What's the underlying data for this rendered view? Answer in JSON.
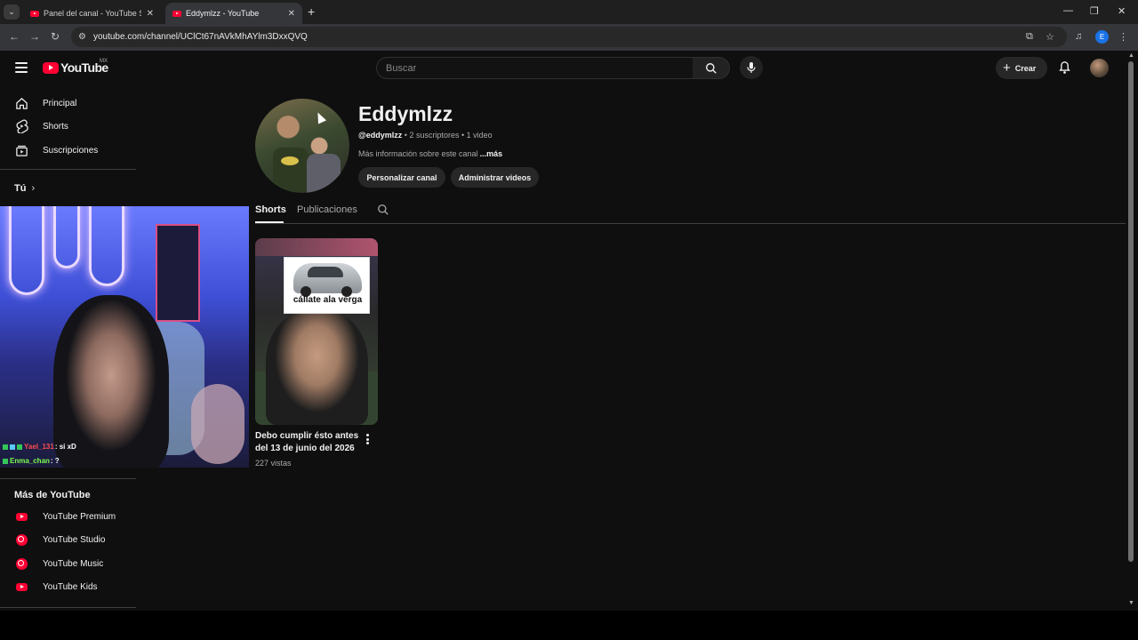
{
  "browser": {
    "tabs": [
      {
        "title": "Panel del canal - YouTube Studio",
        "close": "✕"
      },
      {
        "title": "Eddymlzz - YouTube",
        "close": "✕"
      }
    ],
    "new_tab": "+",
    "window_controls": {
      "minimize": "—",
      "restore": "❐",
      "close": "✕"
    },
    "url": "youtube.com/channel/UClCt67nAVkMhAYlm3DxxQVQ",
    "profile_initial": "E"
  },
  "masthead": {
    "logo_text": "YouTube",
    "region": "MX",
    "search_placeholder": "Buscar",
    "create_label": "Crear"
  },
  "sidebar": {
    "main_items": [
      {
        "label": "Principal",
        "icon": "home-icon"
      },
      {
        "label": "Shorts",
        "icon": "shorts-icon"
      },
      {
        "label": "Suscripciones",
        "icon": "subscriptions-icon"
      }
    ],
    "you_label": "Tú",
    "you_chevron": "›",
    "more_heading": "Más de YouTube",
    "more_items": [
      {
        "label": "YouTube Premium",
        "icon": "youtube-premium-icon"
      },
      {
        "label": "YouTube Studio",
        "icon": "youtube-studio-icon"
      },
      {
        "label": "YouTube Music",
        "icon": "youtube-music-icon"
      },
      {
        "label": "YouTube Kids",
        "icon": "youtube-kids-icon"
      }
    ]
  },
  "webcam_chat": [
    {
      "user": "Yael_131",
      "message": ": si xD",
      "user_color": "#ff4d4d"
    },
    {
      "user": "Enma_chan",
      "message": ": ?",
      "user_color": "#7cff4f"
    }
  ],
  "channel": {
    "name": "Eddymlzz",
    "handle": "@eddymlzz",
    "subscribers": "2 suscriptores",
    "videos": "1 video",
    "separator": " • ",
    "about": "Más información sobre este canal",
    "more": "...más",
    "customize_button": "Personalizar canal",
    "manage_button": "Administrar videos"
  },
  "channel_tabs": [
    {
      "label": "Shorts",
      "active": true
    },
    {
      "label": "Publicaciones",
      "active": false
    }
  ],
  "shorts": [
    {
      "meme_caption": "cállate ala verga",
      "title": "Debo cumplir ésto antes del 13 de junio del 2026",
      "views": "227 vistas"
    }
  ],
  "colors": {
    "background": "#0f0f0f",
    "brand_red": "#ff0033",
    "text_primary": "#f1f1f1",
    "text_secondary": "#aaaaaa",
    "button_bg": "#272727"
  }
}
